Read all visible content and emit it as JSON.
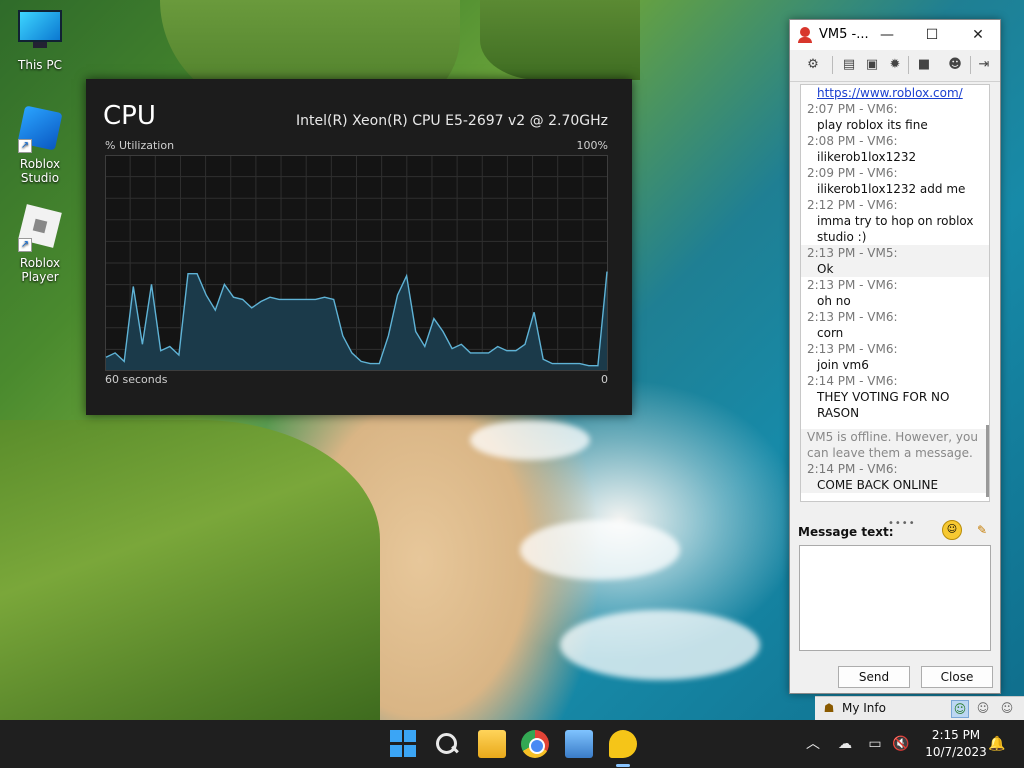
{
  "desktop": {
    "icons": [
      {
        "label": "This PC"
      },
      {
        "label": "Roblox Studio"
      },
      {
        "label": "Roblox Player"
      }
    ]
  },
  "cpu_panel": {
    "title": "CPU",
    "model": "Intel(R) Xeon(R) CPU E5-2697 v2 @ 2.70GHz",
    "utilization_label": "% Utilization",
    "max_label": "100%",
    "time_label": "60 seconds",
    "min_label": "0",
    "colors": {
      "line": "#5fb3d6",
      "fill": "#1b3a4a",
      "grid": "#2f2f2f"
    },
    "chart_data": {
      "type": "area",
      "ylim": [
        0,
        100
      ],
      "values": [
        6,
        8,
        4,
        39,
        12,
        40,
        9,
        11,
        7,
        45,
        45,
        35,
        28,
        40,
        34,
        33,
        29,
        32,
        34,
        33,
        33,
        33,
        33,
        33,
        34,
        33,
        16,
        8,
        4,
        3,
        3,
        16,
        35,
        44,
        18,
        11,
        24,
        18,
        10,
        12,
        8,
        8,
        8,
        11,
        9,
        9,
        12,
        27,
        5,
        3,
        3,
        3,
        3,
        2,
        2,
        46
      ]
    }
  },
  "chat_window": {
    "title": "VM5 -...",
    "controls": {
      "minimize": "—",
      "maximize": "☐",
      "close": "✕"
    },
    "messages": [
      {
        "meta": "",
        "text": "https://www.roblox.com/",
        "link": true
      },
      {
        "meta": "2:07 PM - VM6:",
        "text": "play roblox its fine"
      },
      {
        "meta": "2:08 PM - VM6:",
        "text": "ilikerob1lox1232"
      },
      {
        "meta": "2:09 PM - VM6:",
        "text": "ilikerob1lox1232 add me"
      },
      {
        "meta": "2:12 PM - VM6:",
        "text": "imma try to hop on roblox",
        "text2": "studio :)"
      },
      {
        "meta": "2:13 PM - VM5:",
        "text": "Ok"
      },
      {
        "meta": "2:13 PM - VM6:",
        "text": "oh no"
      },
      {
        "meta": "2:13 PM - VM6:",
        "text": "corn"
      },
      {
        "meta": "2:13 PM - VM6:",
        "text": "join vm6"
      },
      {
        "meta": "2:14 PM - VM6:",
        "text": "THEY VOTING FOR NO",
        "text2": "RASON"
      }
    ],
    "offline_notice": [
      "VM5 is offline. However, you",
      "can leave them a message."
    ],
    "last_message": {
      "meta": "2:14 PM - VM6:",
      "text": "COME BACK ONLINE"
    },
    "message_label": "Message text:",
    "input_value": "",
    "send_label": "Send",
    "close_label": "Close"
  },
  "myinfo_bar": {
    "label": "My Info"
  },
  "taskbar": {
    "time": "2:15 PM",
    "date": "10/7/2023"
  }
}
